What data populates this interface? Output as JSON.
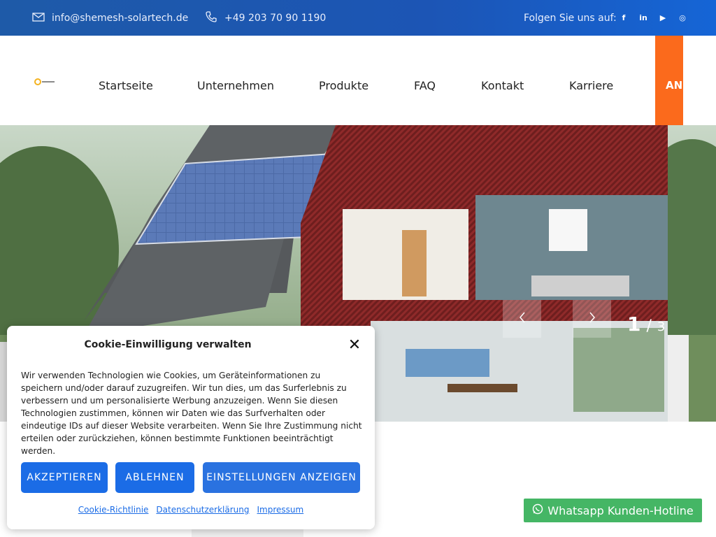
{
  "topbar": {
    "email": "info@shemesh-solartech.de",
    "phone": "+49 203 70 90 1190",
    "follow": "Folgen Sie uns auf:",
    "socials": [
      {
        "icon": "facebook-icon",
        "glyph": "f"
      },
      {
        "icon": "linkedin-icon",
        "glyph": "in"
      },
      {
        "icon": "youtube-icon",
        "glyph": "▶"
      },
      {
        "icon": "instagram-icon",
        "glyph": "◎"
      }
    ]
  },
  "nav": {
    "items": [
      "Startseite",
      "Unternehmen",
      "Produkte",
      "FAQ",
      "Kontakt",
      "Karriere"
    ],
    "cta": "ANFRAGE"
  },
  "slider": {
    "current": "1",
    "separator": "/",
    "total": "3"
  },
  "cookie": {
    "title": "Cookie-Einwilligung verwalten",
    "body": "Wir verwenden Technologien wie Cookies, um Geräteinformationen zu speichern und/oder darauf zuzugreifen. Wir tun dies, um das Surferlebnis zu verbessern und um personalisierte Werbung anzuzeigen. Wenn Sie diesen Technologien zustimmen, können wir Daten wie das Surfverhalten oder eindeutige IDs auf dieser Website verarbeiten. Wenn Sie Ihre Zustimmung nicht erteilen oder zurückziehen, können bestimmte Funktionen beeinträchtigt werden.",
    "accept": "AKZEPTIEREN",
    "decline": "ABLEHNEN",
    "settings": "EINSTELLUNGEN ANZEIGEN",
    "links": [
      "Cookie-Richtlinie",
      "Datenschutzerklärung",
      "Impressum"
    ]
  },
  "whatsapp": {
    "label": "Whatsapp Kunden-Hotline"
  },
  "colors": {
    "topbar": "#1c55b5",
    "cta": "#fb6a1c",
    "button": "#1b6ce6",
    "whatsapp": "#45b665"
  }
}
